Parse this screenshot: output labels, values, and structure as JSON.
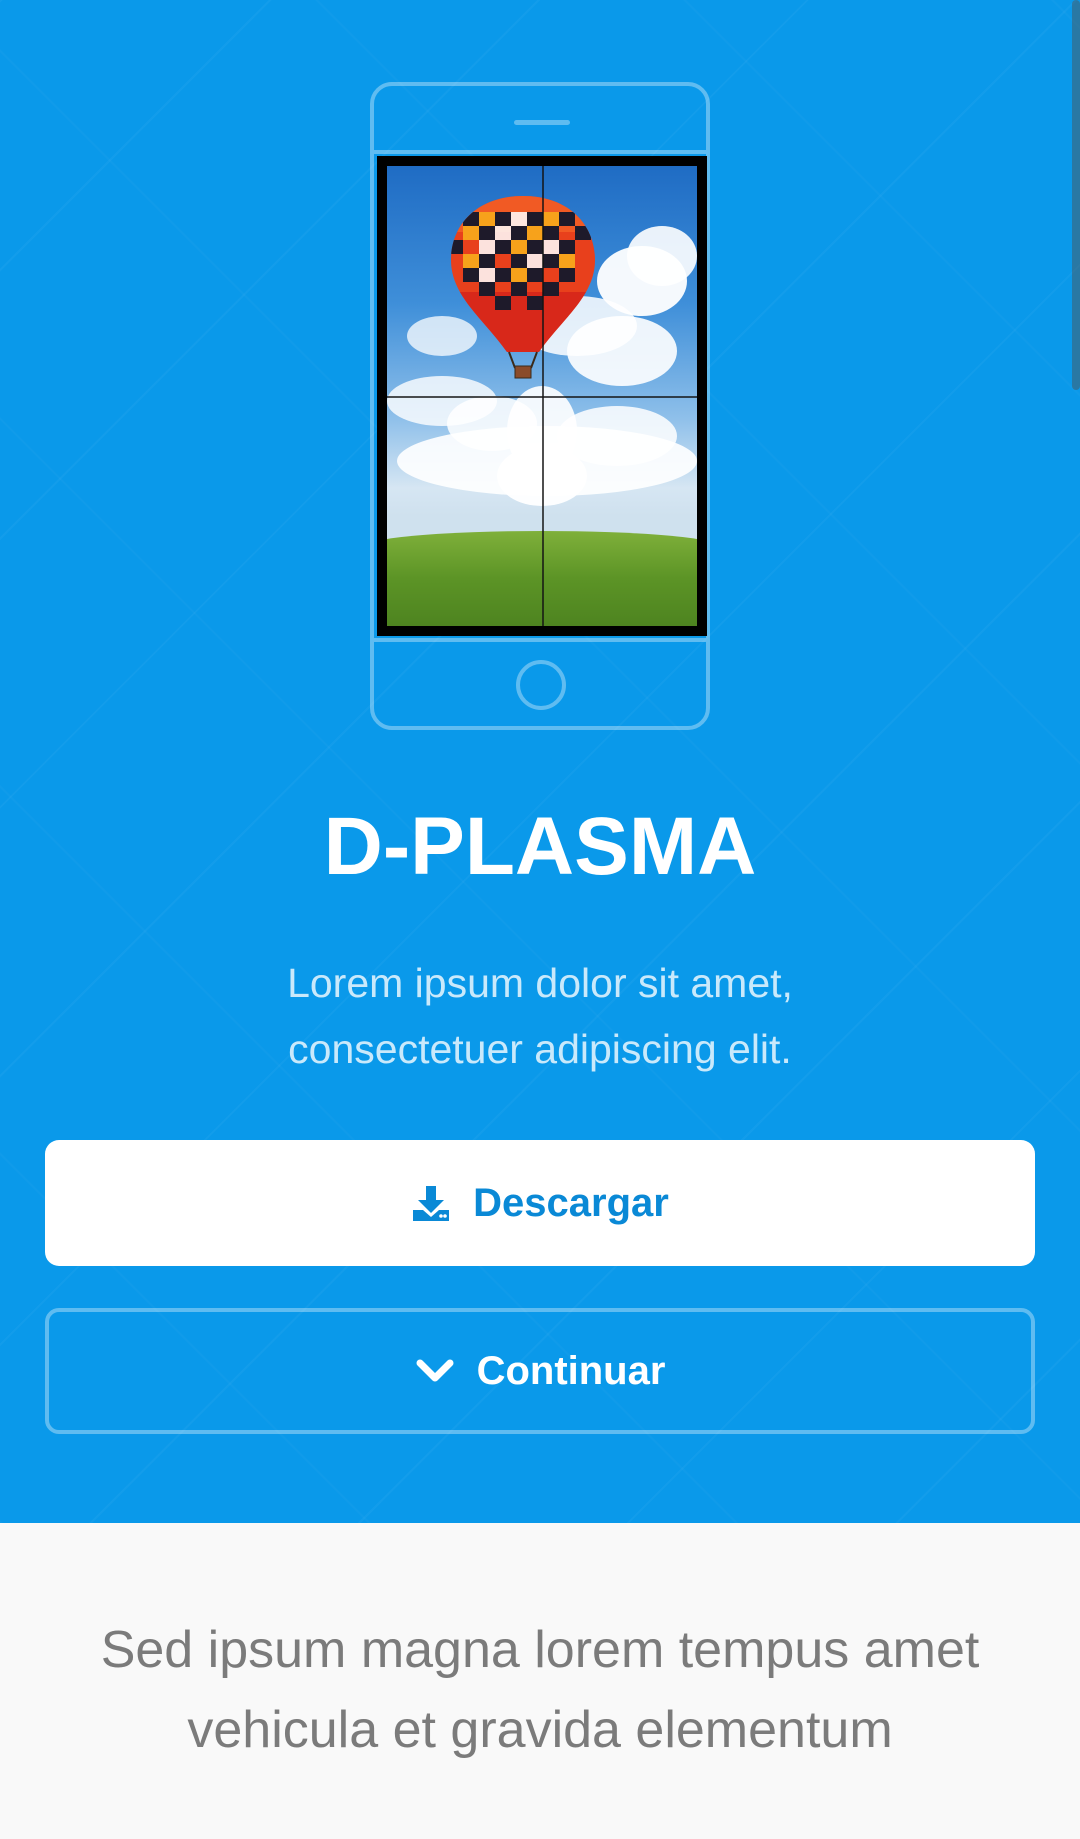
{
  "hero": {
    "title": "D-PLASMA",
    "subtitle_line1": "Lorem ipsum dolor sit amet,",
    "subtitle_line2": "consectetuer adipiscing elit.",
    "background_color": "#0a99ea"
  },
  "buttons": {
    "download_label": "Descargar",
    "download_icon": "download-icon",
    "continue_label": "Continuar",
    "continue_icon": "chevron-down-icon"
  },
  "lower": {
    "text_line1": "Sed ipsum magna lorem tempus amet",
    "text_line2": "vehicula et gravida elementum"
  },
  "colors": {
    "accent": "#0a89d6",
    "lower_bg": "#f9f9f9",
    "lower_text": "#7b7b7b"
  }
}
